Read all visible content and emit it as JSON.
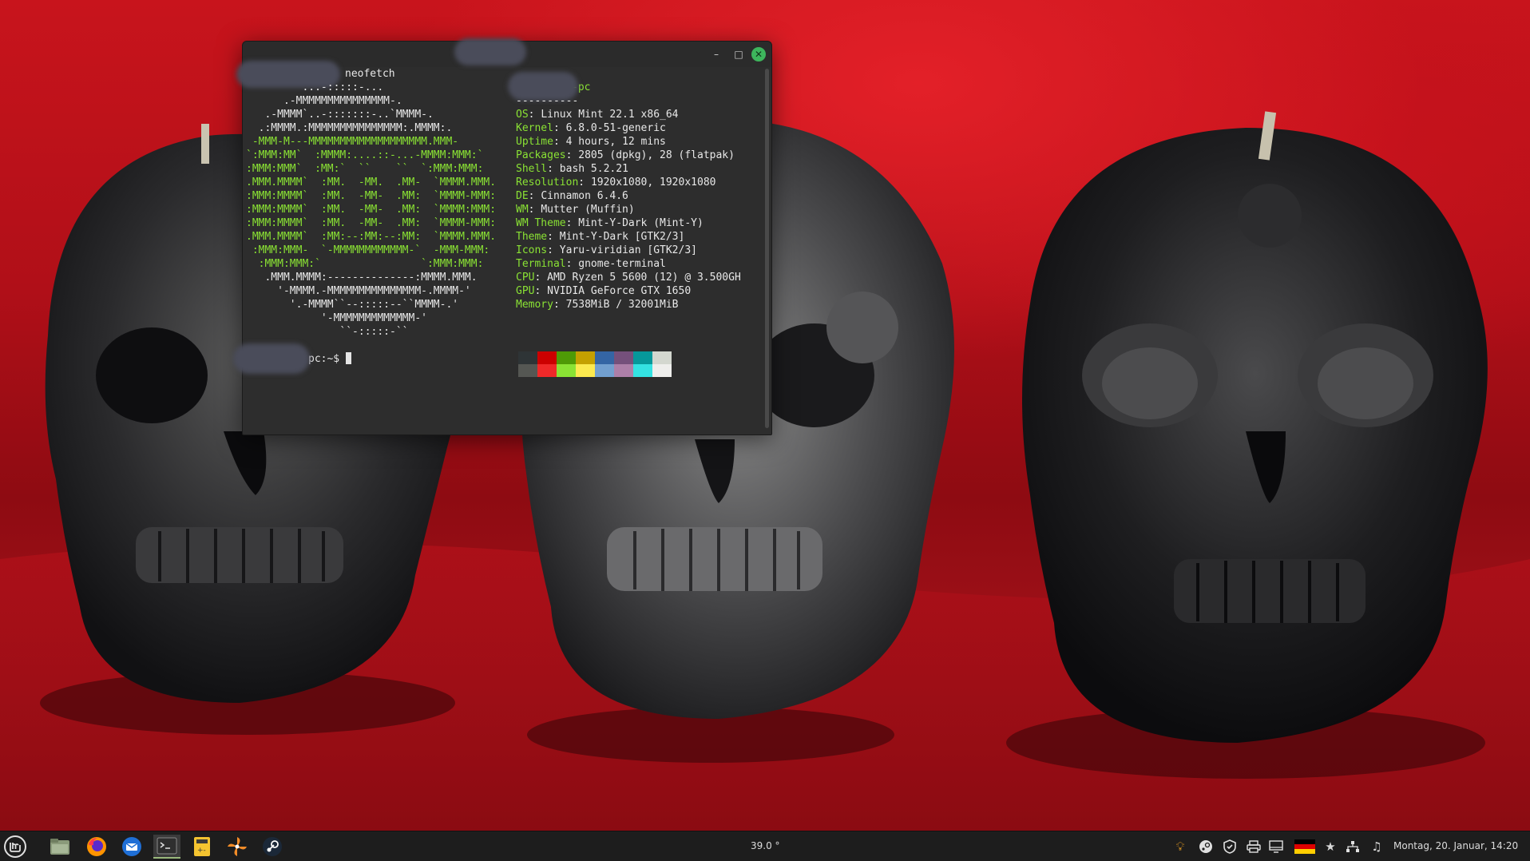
{
  "window": {
    "title": "pc: ~",
    "minimize_glyph": "–",
    "maximize_glyph": "□",
    "close_glyph": "✕"
  },
  "terminal": {
    "command_line": "neofetch",
    "hostname_suffix": "-pc",
    "separator": "----------",
    "ascii": [
      "         ...-:::::-...",
      "      .-MMMMMMMMMMMMMMM-.",
      "   .-MMMM`..-:::::::-..`MMMM-.",
      "  .:MMMM.:MMMMMMMMMMMMMMM:.MMMM:.",
      " -MMM-M---MMMMMMMMMMMMMMMMMMM.MMM-",
      "`:MMM:MM`  :MMMM:....::-...-MMMM:MMM:`",
      ":MMM:MMM`  :MM:`  ``    ``  `:MMM:MMM:",
      ".MMM.MMMM`  :MM.  -MM.  .MM-  `MMMM.MMM.",
      ":MMM:MMMM`  :MM.  -MM-  .MM:  `MMMM-MMM:",
      ":MMM:MMMM`  :MM.  -MM-  .MM:  `MMMM:MMM:",
      ":MMM:MMMM`  :MM.  -MM-  .MM:  `MMMM-MMM:",
      ".MMM.MMMM`  :MM:--:MM:--:MM:  `MMMM.MMM.",
      " :MMM:MMM-  `-MMMMMMMMMMMM-`  -MMM-MMM:",
      "  :MMM:MMM:`                `:MMM:MMM:",
      "   .MMM.MMMM:--------------:MMMM.MMM.",
      "     '-MMMM.-MMMMMMMMMMMMMMM-.MMMM-'",
      "       '.-MMMM``--:::::--``MMMM-.'",
      "            '-MMMMMMMMMMMMM-'",
      "               ``-:::::-``"
    ],
    "info": [
      {
        "label": "OS",
        "value": "Linux Mint 22.1 x86_64"
      },
      {
        "label": "Kernel",
        "value": "6.8.0-51-generic"
      },
      {
        "label": "Uptime",
        "value": "4 hours, 12 mins"
      },
      {
        "label": "Packages",
        "value": "2805 (dpkg), 28 (flatpak)"
      },
      {
        "label": "Shell",
        "value": "bash 5.2.21"
      },
      {
        "label": "Resolution",
        "value": "1920x1080, 1920x1080"
      },
      {
        "label": "DE",
        "value": "Cinnamon 6.4.6"
      },
      {
        "label": "WM",
        "value": "Mutter (Muffin)"
      },
      {
        "label": "WM Theme",
        "value": "Mint-Y-Dark (Mint-Y)"
      },
      {
        "label": "Theme",
        "value": "Mint-Y-Dark [GTK2/3]"
      },
      {
        "label": "Icons",
        "value": "Yaru-viridian [GTK2/3]"
      },
      {
        "label": "Terminal",
        "value": "gnome-terminal"
      },
      {
        "label": "CPU",
        "value": "AMD Ryzen 5 5600 (12) @ 3.500GH"
      },
      {
        "label": "GPU",
        "value": "NVIDIA GeForce GTX 1650"
      },
      {
        "label": "Memory",
        "value": "7538MiB / 32001MiB"
      }
    ],
    "palette_top": [
      "#2e3436",
      "#cc0000",
      "#4e9a06",
      "#c4a000",
      "#3465a4",
      "#75507b",
      "#06989a",
      "#d3d7cf"
    ],
    "palette_bottom": [
      "#555753",
      "#ef2929",
      "#8ae234",
      "#fce94f",
      "#729fcf",
      "#ad7fa8",
      "#34e2e2",
      "#eeeeec"
    ],
    "prompt": "pc:~$ "
  },
  "taskbar": {
    "apps": [
      {
        "name": "mint-menu-icon"
      },
      {
        "name": "file-manager-icon"
      },
      {
        "name": "firefox-icon"
      },
      {
        "name": "thunderbird-icon"
      },
      {
        "name": "terminal-icon"
      },
      {
        "name": "calculator-icon"
      },
      {
        "name": "pinwheel-app-icon"
      },
      {
        "name": "steam-icon"
      }
    ],
    "temperature": "39.0 °",
    "clock": "Montag, 20. Januar, 14:20"
  },
  "colors": {
    "accent_green": "#8ae234",
    "terminal_bg": "#2d2d2d",
    "taskbar_bg": "#1d1d1d",
    "close_button": "#3db55c"
  }
}
